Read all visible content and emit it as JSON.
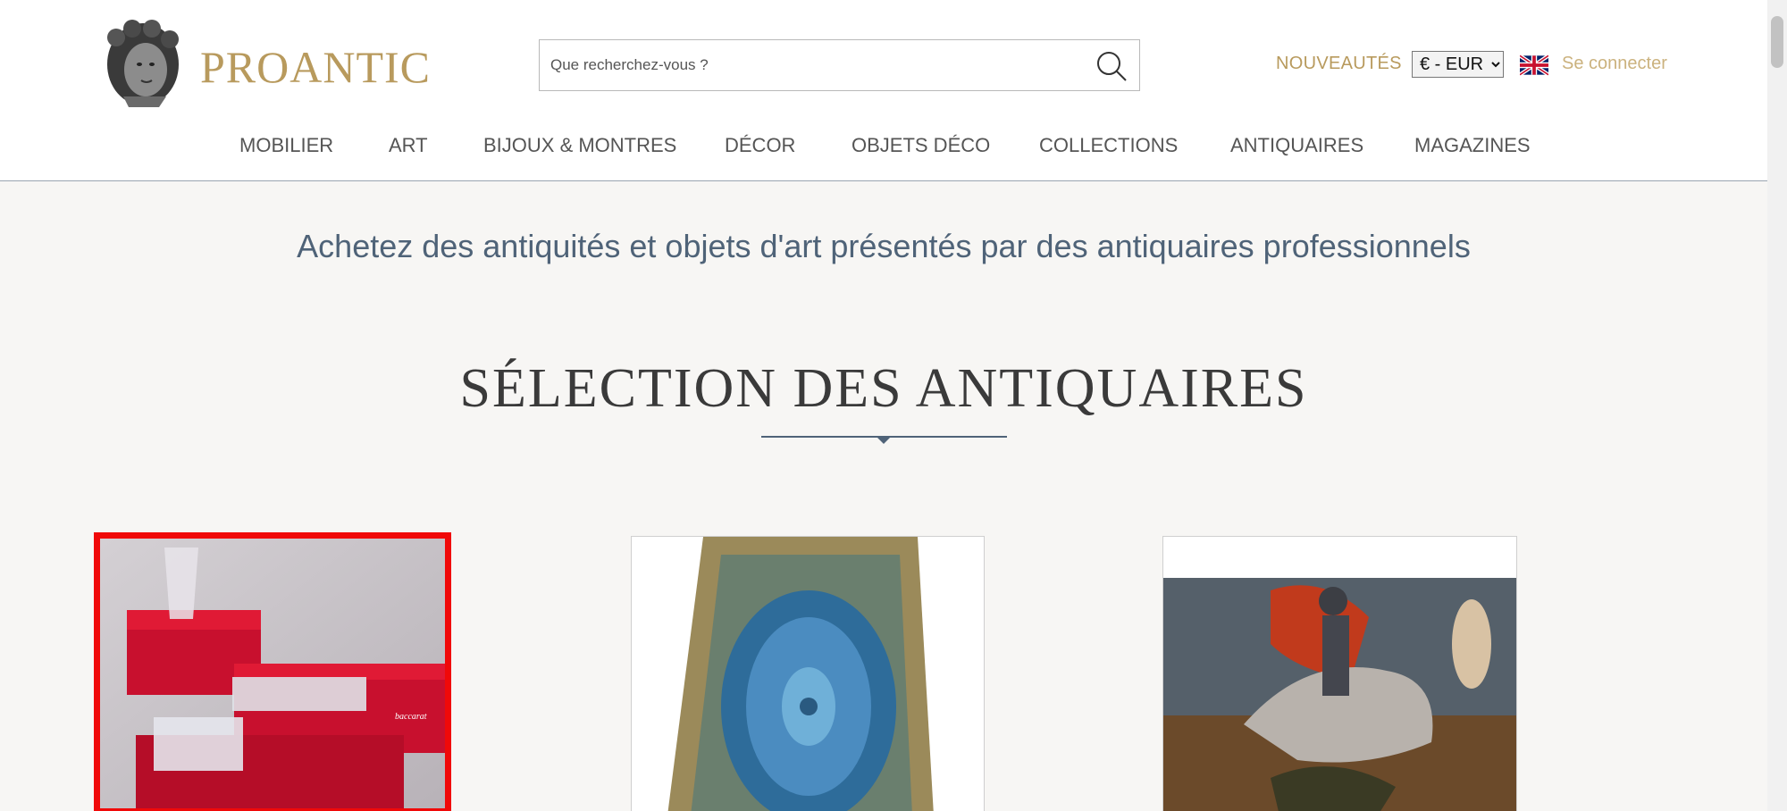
{
  "header": {
    "brand": "PROANTIC",
    "search": {
      "placeholder": "Que recherchez-vous ?"
    },
    "nouveautes": "NOUVEAUTÉS",
    "currency": {
      "selected": "€ - EUR"
    },
    "login": "Se connecter"
  },
  "nav": {
    "items": [
      {
        "label": "MOBILIER"
      },
      {
        "label": "ART"
      },
      {
        "label": "BIJOUX & MONTRES"
      },
      {
        "label": "DÉCOR"
      },
      {
        "label": "OBJETS DÉCO"
      },
      {
        "label": "COLLECTIONS"
      },
      {
        "label": "ANTIQUAIRES"
      },
      {
        "label": "MAGAZINES"
      }
    ]
  },
  "main": {
    "tagline": "Achetez des antiquités et objets d'art présentés par des antiquaires professionnels",
    "section_title": "SÉLECTION DES ANTIQUAIRES",
    "cards": [
      {
        "label": "baccarat"
      },
      {
        "label": ""
      },
      {
        "label": ""
      }
    ]
  },
  "colors": {
    "gold": "#b89a5d",
    "slate": "#4f6378",
    "selection_red": "#f00909"
  }
}
